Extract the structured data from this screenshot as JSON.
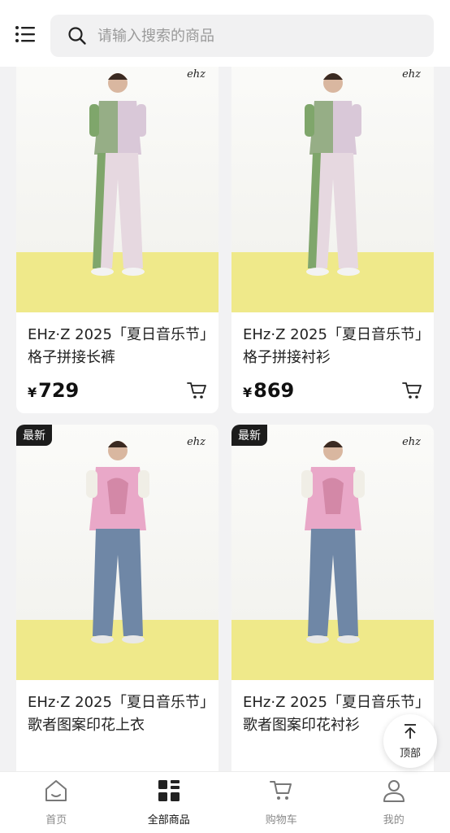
{
  "search": {
    "placeholder": "请输入搜索的商品"
  },
  "products": [
    {
      "badge": "",
      "brand_mark": "ehz",
      "title": "EHz·Z 2025「夏日音乐节」格子拼接长裤",
      "currency": "¥",
      "price": "729",
      "outfit": "plaid"
    },
    {
      "badge": "",
      "brand_mark": "ehz",
      "title": "EHz·Z 2025「夏日音乐节」格子拼接衬衫",
      "currency": "¥",
      "price": "869",
      "outfit": "plaid"
    },
    {
      "badge": "最新",
      "brand_mark": "ehz",
      "title": "EHz·Z 2025「夏日音乐节」歌者图案印花上衣",
      "currency": "",
      "price": "",
      "outfit": "pink"
    },
    {
      "badge": "最新",
      "brand_mark": "ehz",
      "title": "EHz·Z 2025「夏日音乐节」歌者图案印花衬衫",
      "currency": "",
      "price": "",
      "outfit": "pink"
    }
  ],
  "back_to_top": {
    "label": "顶部"
  },
  "tabbar": [
    {
      "label": "首页",
      "icon": "home-icon",
      "active": false
    },
    {
      "label": "全部商品",
      "icon": "grid-icon",
      "active": true
    },
    {
      "label": "购物车",
      "icon": "cart-icon",
      "active": false
    },
    {
      "label": "我的",
      "icon": "user-icon",
      "active": false
    }
  ],
  "colors": {
    "floor": "#efe98a",
    "plaid_green": "#7fa66b",
    "shirt_lilac": "#d9c8d8",
    "pink_print": "#e9a8c8",
    "denim": "#6f87a6"
  }
}
